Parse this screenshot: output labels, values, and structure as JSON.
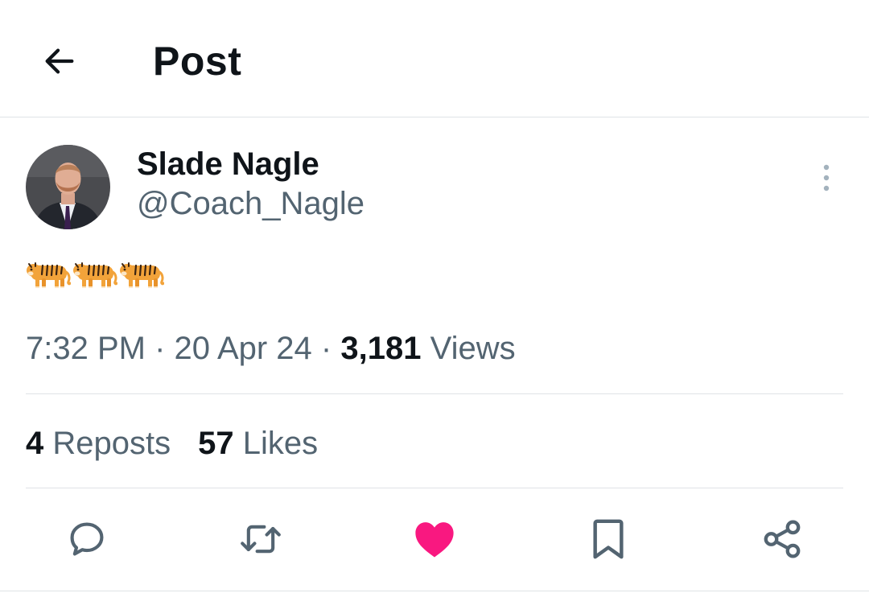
{
  "header": {
    "title": "Post",
    "back_icon": "arrow-left-icon"
  },
  "post": {
    "author": {
      "display_name": "Slade Nagle",
      "handle": "@Coach_Nagle"
    },
    "text": "🐅🐅🐅",
    "time": "7:32 PM",
    "date": "20 Apr 24",
    "separator": "·",
    "views_count": "3,181",
    "views_label": "Views",
    "reposts_count": "4",
    "reposts_label": "Reposts",
    "likes_count": "57",
    "likes_label": "Likes",
    "liked": true
  },
  "actions": [
    {
      "name": "reply",
      "icon": "speech-bubble-icon"
    },
    {
      "name": "repost",
      "icon": "repost-arrows-icon"
    },
    {
      "name": "like",
      "icon": "heart-icon",
      "color": "#f91880"
    },
    {
      "name": "bookmark",
      "icon": "bookmark-icon"
    },
    {
      "name": "share",
      "icon": "share-icon"
    }
  ],
  "colors": {
    "text_primary": "#0f1419",
    "text_secondary": "#536471",
    "like_active": "#f91880",
    "divider": "#dfe3e6"
  }
}
